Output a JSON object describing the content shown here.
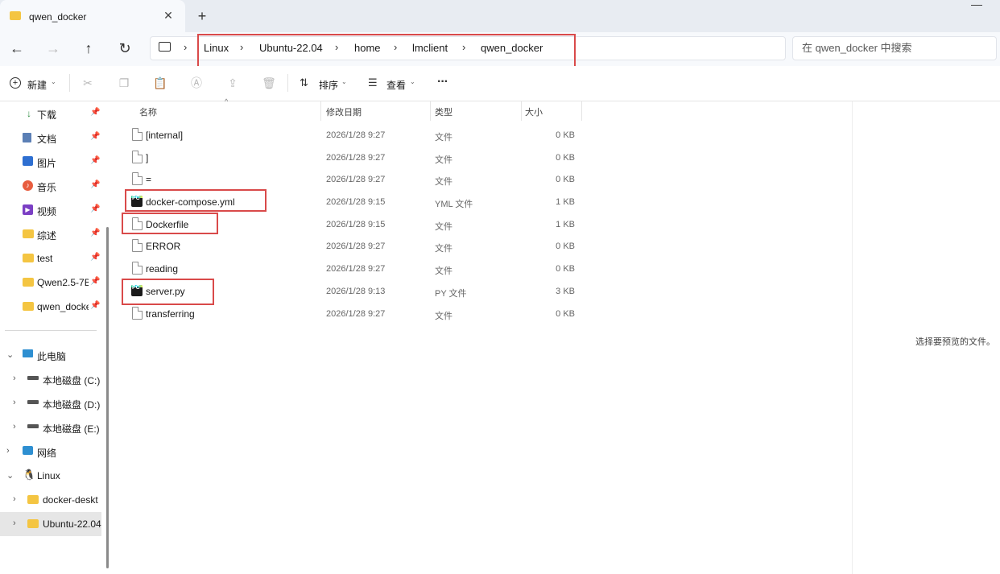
{
  "window": {
    "tab_title": "qwen_docker",
    "new_tab": "+",
    "close": "✕",
    "minimize": "—"
  },
  "nav": {
    "back": "←",
    "forward": "→",
    "up": "↑",
    "refresh": "↻",
    "breadcrumb": [
      "Linux",
      "Ubuntu-22.04",
      "home",
      "lmclient",
      "qwen_docker"
    ],
    "separator": "›",
    "search_placeholder": "在 qwen_docker 中搜索"
  },
  "toolbar": {
    "new_label": "新建",
    "sort_label": "排序",
    "view_label": "查看",
    "more": "···"
  },
  "sidebar": {
    "quick": [
      {
        "label": "下载",
        "icon": "download-icon"
      },
      {
        "label": "文档",
        "icon": "document-icon"
      },
      {
        "label": "图片",
        "icon": "picture-icon"
      },
      {
        "label": "音乐",
        "icon": "music-icon"
      },
      {
        "label": "视频",
        "icon": "video-icon"
      },
      {
        "label": "综述",
        "icon": "folder-icon"
      },
      {
        "label": "test",
        "icon": "folder-icon"
      },
      {
        "label": "Qwen2.5-7B",
        "icon": "folder-icon"
      },
      {
        "label": "qwen_docke",
        "icon": "folder-icon"
      }
    ],
    "tree": [
      {
        "label": "此电脑",
        "icon": "computer-icon"
      },
      {
        "label": "本地磁盘 (C:)",
        "icon": "drive-icon"
      },
      {
        "label": "本地磁盘 (D:)",
        "icon": "drive-icon"
      },
      {
        "label": "本地磁盘 (E:)",
        "icon": "drive-icon"
      },
      {
        "label": "网络",
        "icon": "network-icon"
      },
      {
        "label": "Linux",
        "icon": "linux-icon"
      },
      {
        "label": "docker-deskt",
        "icon": "folder-icon"
      },
      {
        "label": "Ubuntu-22.04",
        "icon": "folder-icon"
      }
    ]
  },
  "columns": {
    "name": "名称",
    "date": "修改日期",
    "type": "类型",
    "size": "大小"
  },
  "files": [
    {
      "name": "[internal]",
      "date": "2026/1/28 9:27",
      "type": "文件",
      "size": "0 KB",
      "icon": "file-icon"
    },
    {
      "name": "]",
      "date": "2026/1/28 9:27",
      "type": "文件",
      "size": "0 KB",
      "icon": "file-icon"
    },
    {
      "name": "=",
      "date": "2026/1/28 9:27",
      "type": "文件",
      "size": "0 KB",
      "icon": "file-icon"
    },
    {
      "name": "docker-compose.yml",
      "date": "2026/1/28 9:15",
      "type": "YML 文件",
      "size": "1 KB",
      "icon": "pycharm-icon"
    },
    {
      "name": "Dockerfile",
      "date": "2026/1/28 9:15",
      "type": "文件",
      "size": "1 KB",
      "icon": "file-icon"
    },
    {
      "name": "ERROR",
      "date": "2026/1/28 9:27",
      "type": "文件",
      "size": "0 KB",
      "icon": "file-icon"
    },
    {
      "name": "reading",
      "date": "2026/1/28 9:27",
      "type": "文件",
      "size": "0 KB",
      "icon": "file-icon"
    },
    {
      "name": "server.py",
      "date": "2026/1/28 9:13",
      "type": "PY 文件",
      "size": "3 KB",
      "icon": "pycharm-icon"
    },
    {
      "name": "transferring",
      "date": "2026/1/28 9:27",
      "type": "文件",
      "size": "0 KB",
      "icon": "file-icon"
    }
  ],
  "preview": {
    "message": "选择要预览的文件。"
  },
  "colors": {
    "highlight": "#d94a4a",
    "accent": "#0067c0"
  }
}
